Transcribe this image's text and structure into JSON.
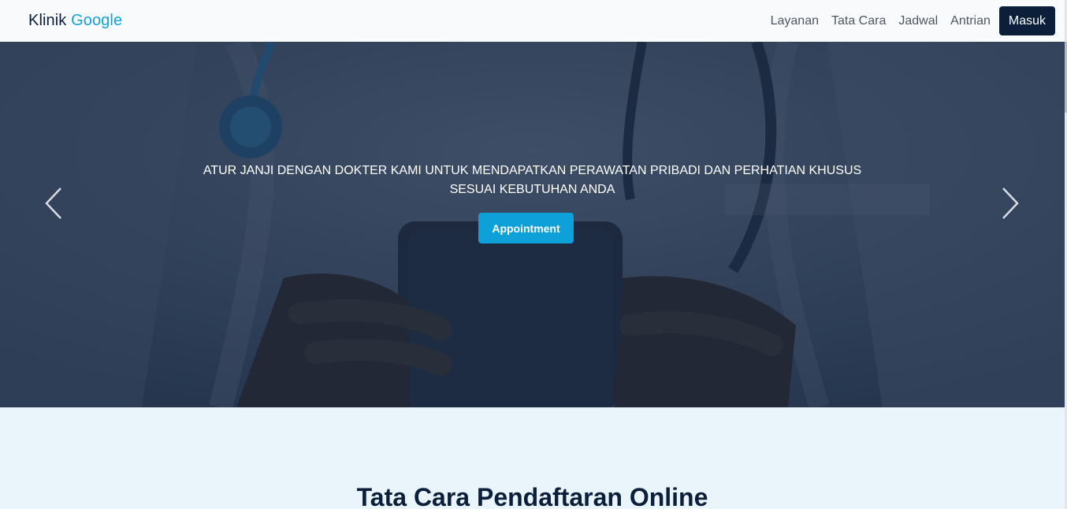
{
  "navbar": {
    "brand_part1": "Klinik",
    "brand_part2": "Google",
    "links": [
      "Layanan",
      "Tata Cara",
      "Jadwal",
      "Antrian"
    ],
    "login_label": "Masuk"
  },
  "hero": {
    "caption": "ATUR JANJI DENGAN DOKTER KAMI UNTUK MENDAPATKAN PERAWATAN PRIBADI DAN PERHATIAN KHUSUS SESUAI KEBUTUHAN ANDA",
    "cta_label": "Appointment",
    "prev_icon": "chevron-left-icon",
    "next_icon": "chevron-right-icon"
  },
  "section": {
    "title": "Tata Cara Pendaftaran Online"
  },
  "colors": {
    "navy": "#0b1f3a",
    "accent": "#11a3d8",
    "cta": "#0ea0d9",
    "section_bg": "#eaf5fb"
  }
}
